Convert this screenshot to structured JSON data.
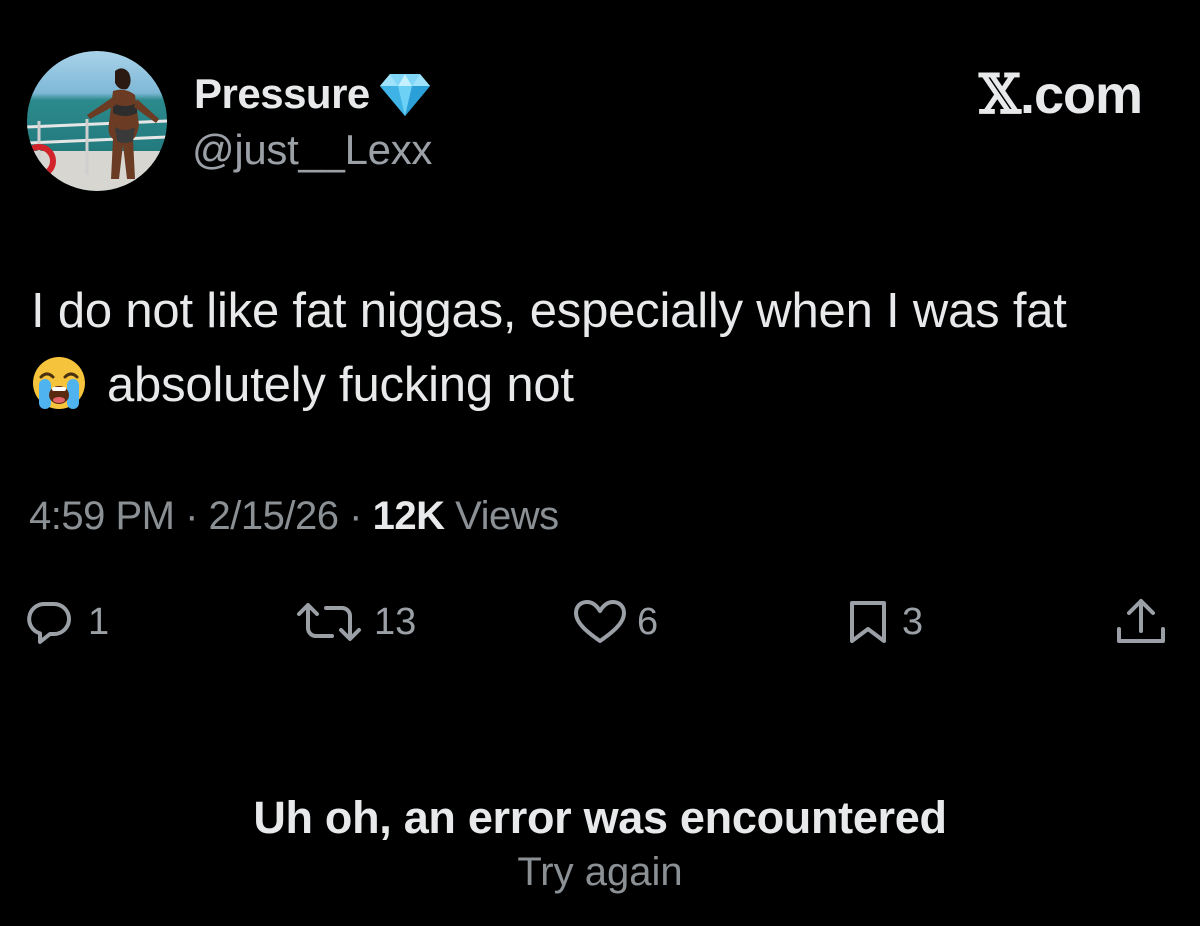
{
  "author": {
    "display_name": "Pressure",
    "handle": "@just__Lexx",
    "avatar_icon": "profile-photo",
    "verified_icon": "diamond-icon"
  },
  "site": {
    "x_letter": "𝕏",
    "suffix": ".com"
  },
  "tweet": {
    "line1": "I do not like fat niggas, especially when I was fat",
    "line2": "absolutely fucking not",
    "emoji": "loudly-crying-face"
  },
  "meta": {
    "time": "4:59 PM",
    "separator1": "·",
    "date": "2/15/26",
    "separator2": "·",
    "views_count": "12K",
    "views_label": "Views"
  },
  "actions": {
    "replies": "1",
    "reposts": "13",
    "likes": "6",
    "bookmarks": "3"
  },
  "error": {
    "title": "Uh oh, an error was encountered",
    "retry_label": "Try again"
  },
  "colors": {
    "background": "#000000",
    "primary_text": "#e7e9ea",
    "secondary_text": "#8b9095",
    "diamond": "#5ec8f2"
  }
}
